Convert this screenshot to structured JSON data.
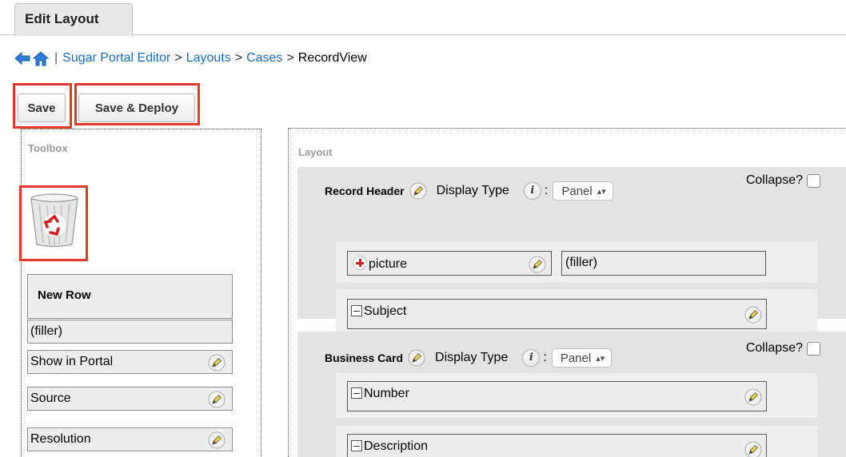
{
  "tab": {
    "label": "Edit Layout"
  },
  "breadcrumb": {
    "separator": "|",
    "items": [
      "Sugar Portal Editor",
      "Layouts",
      "Cases"
    ],
    "current": "RecordView",
    "arrow": ">"
  },
  "toolbar": {
    "save_label": "Save",
    "save_deploy_label": "Save & Deploy"
  },
  "toolbox": {
    "title": "Toolbox",
    "new_row_label": "New Row",
    "filler_label": "(filler)",
    "fields": [
      "Show in Portal",
      "Source",
      "Resolution"
    ]
  },
  "layout": {
    "title": "Layout",
    "display_type_label": "Display Type",
    "collapse_label": "Collapse?",
    "panels": [
      {
        "name": "Record Header",
        "display_type": "Panel",
        "rows": [
          {
            "left": "picture",
            "right": "(filler)"
          },
          {
            "full": "Subject"
          }
        ]
      },
      {
        "name": "Business Card",
        "display_type": "Panel",
        "rows": [
          {
            "full": "Number"
          },
          {
            "full": "Description"
          }
        ]
      }
    ]
  },
  "colors": {
    "highlight": "#e53a2a",
    "link": "#1b6ec2"
  }
}
